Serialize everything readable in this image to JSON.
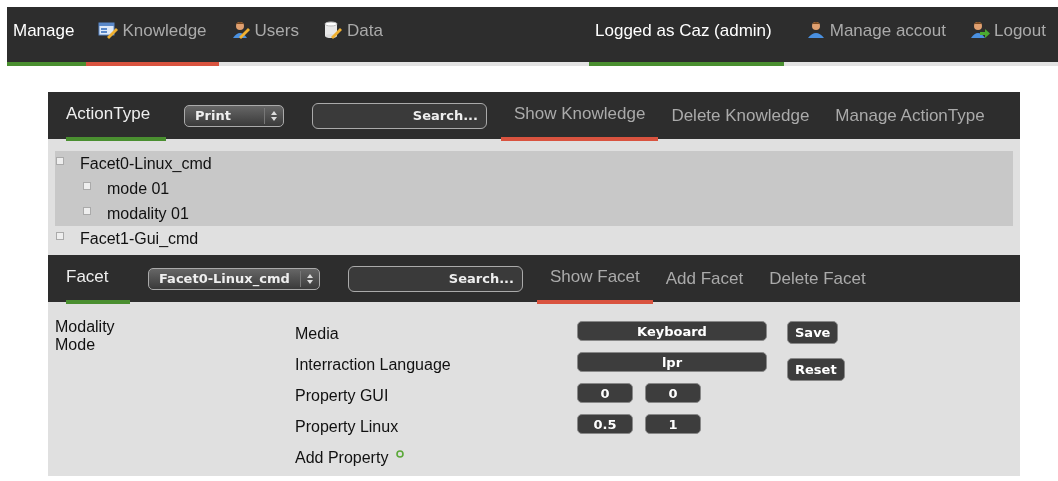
{
  "nav": {
    "items": [
      {
        "kind": "title",
        "label": "Manage"
      },
      {
        "kind": "tab",
        "label": "Knowledge",
        "selected": true
      },
      {
        "kind": "tab",
        "label": "Users",
        "selected": false
      },
      {
        "kind": "tab",
        "label": "Data",
        "selected": false
      }
    ],
    "right": [
      {
        "kind": "title",
        "label": "Logged as Caz (admin)"
      },
      {
        "kind": "tab",
        "label": "Manage accout",
        "selected": false
      },
      {
        "kind": "tab",
        "label": "Logout",
        "selected": false
      }
    ]
  },
  "action_panel": {
    "label": "ActionType",
    "select": "Print",
    "search": {
      "placeholder": "Search..."
    },
    "links": [
      {
        "label": "Show Knowledge",
        "selected": true
      },
      {
        "label": "Delete Knowledge",
        "selected": false
      },
      {
        "label": "Manage ActionType",
        "selected": false
      }
    ],
    "tree": [
      {
        "label": "Facet0-Linux_cmd",
        "expanded": true,
        "children": [
          {
            "label": "mode 01"
          },
          {
            "label": "modality 01"
          }
        ]
      },
      {
        "label": "Facet1-Gui_cmd",
        "expanded": false
      }
    ]
  },
  "facet_panel": {
    "label": "Facet",
    "select": "Facet0-Linux_cmd",
    "search": {
      "placeholder": "Search..."
    },
    "links": [
      {
        "label": "Show Facet",
        "selected": true
      },
      {
        "label": "Add Facet",
        "selected": false
      },
      {
        "label": "Delete Facet",
        "selected": false
      }
    ],
    "side_list": [
      "Modality",
      "Mode"
    ],
    "rows": [
      {
        "label": "Media",
        "values": [
          "Keyboard"
        ]
      },
      {
        "label": "Interraction Language",
        "values": [
          "lpr"
        ]
      },
      {
        "label": "Property GUI",
        "values": [
          "0",
          "0"
        ]
      },
      {
        "label": "Property Linux",
        "values": [
          "0.5",
          "1"
        ]
      }
    ],
    "add_property": "Add Property",
    "buttons": [
      "Save",
      "Reset"
    ]
  }
}
